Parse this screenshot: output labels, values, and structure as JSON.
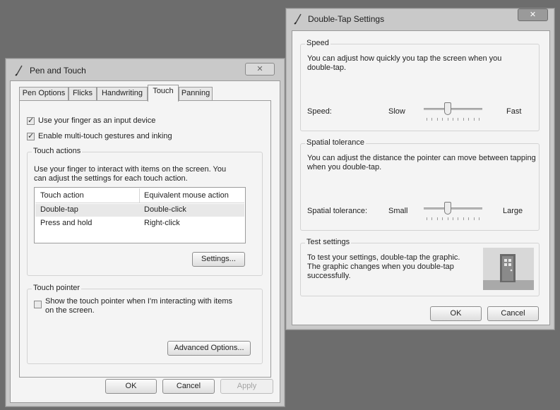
{
  "pen_touch": {
    "title": "Pen and Touch",
    "tabs": [
      {
        "label": "Pen Options"
      },
      {
        "label": "Flicks"
      },
      {
        "label": "Handwriting"
      },
      {
        "label": "Touch"
      },
      {
        "label": "Panning"
      }
    ],
    "active_tab": "Touch",
    "checkbox_finger_input": {
      "label": "Use your finger as an input device",
      "checked": true
    },
    "checkbox_multitouch": {
      "label": "Enable multi-touch gestures and inking",
      "checked": true
    },
    "touch_actions": {
      "group_label": "Touch actions",
      "description": "Use your finger to interact with items on the screen. You can adjust the settings for each touch action.",
      "columns": [
        "Touch action",
        "Equivalent mouse action"
      ],
      "rows": [
        {
          "action": "Double-tap",
          "mouse": "Double-click"
        },
        {
          "action": "Press and hold",
          "mouse": "Right-click"
        }
      ],
      "settings_button": "Settings..."
    },
    "touch_pointer": {
      "group_label": "Touch pointer",
      "checkbox_label": "Show the touch pointer when I'm interacting with items on the screen.",
      "checked": false,
      "advanced_button": "Advanced Options..."
    },
    "buttons": {
      "ok": "OK",
      "cancel": "Cancel",
      "apply": "Apply"
    }
  },
  "double_tap": {
    "title": "Double-Tap Settings",
    "speed": {
      "group_label": "Speed",
      "description": "You can adjust how quickly you tap the screen when you double-tap.",
      "slider_label": "Speed:",
      "min_label": "Slow",
      "max_label": "Fast",
      "value_fraction": 0.4
    },
    "spatial": {
      "group_label": "Spatial tolerance",
      "description": "You can adjust the distance the pointer can move between tapping when you double-tap.",
      "slider_label": "Spatial tolerance:",
      "min_label": "Small",
      "max_label": "Large",
      "value_fraction": 0.4
    },
    "test": {
      "group_label": "Test settings",
      "description": "To test your settings, double-tap the graphic. The graphic changes when you double-tap successfully."
    },
    "buttons": {
      "ok": "OK",
      "cancel": "Cancel"
    }
  }
}
